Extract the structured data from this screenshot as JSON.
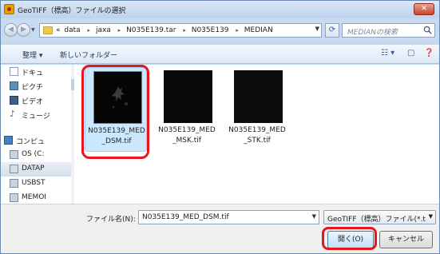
{
  "window": {
    "title": "GeoTIFF（標高）ファイルの選択",
    "close_label": "✕"
  },
  "address": {
    "prefix": "«",
    "crumbs": [
      "data",
      "jaxa",
      "N035E139.tar",
      "N035E139",
      "MEDIAN"
    ],
    "separator": "▸"
  },
  "search": {
    "placeholder": "MEDIANの検索"
  },
  "toolbar": {
    "organize_label": "整理 ▾",
    "new_folder_label": "新しいフォルダー"
  },
  "nav": {
    "items": [
      {
        "label": "ドキュ",
        "icon": "documents-icon"
      },
      {
        "label": "ピクチ",
        "icon": "pictures-icon"
      },
      {
        "label": "ビデオ",
        "icon": "videos-icon"
      },
      {
        "label": "ミュージ",
        "icon": "music-icon"
      },
      {
        "label": "コンピュ",
        "icon": "computer-icon"
      },
      {
        "label": "OS (C:",
        "icon": "drive-icon"
      },
      {
        "label": "DATAP",
        "icon": "drive-icon"
      },
      {
        "label": "USBST",
        "icon": "usb-drive-icon"
      },
      {
        "label": "MEMOI",
        "icon": "usb-drive-icon"
      }
    ]
  },
  "files": [
    {
      "name_line1": "N035E139_MED",
      "name_line2": "_DSM.tif",
      "selected": true
    },
    {
      "name_line1": "N035E139_MED",
      "name_line2": "_MSK.tif",
      "selected": false
    },
    {
      "name_line1": "N035E139_MED",
      "name_line2": "_STK.tif",
      "selected": false
    }
  ],
  "bottom": {
    "filename_label": "ファイル名(N):",
    "filename_value": "N035E139_MED_DSM.tif",
    "filter_value": "GeoTIFF（標高）ファイル(*.t",
    "open_label": "開く(O)",
    "cancel_label": "キャンセル"
  },
  "colors": {
    "highlight": "#e8141e",
    "selection": "#cce8ff"
  }
}
